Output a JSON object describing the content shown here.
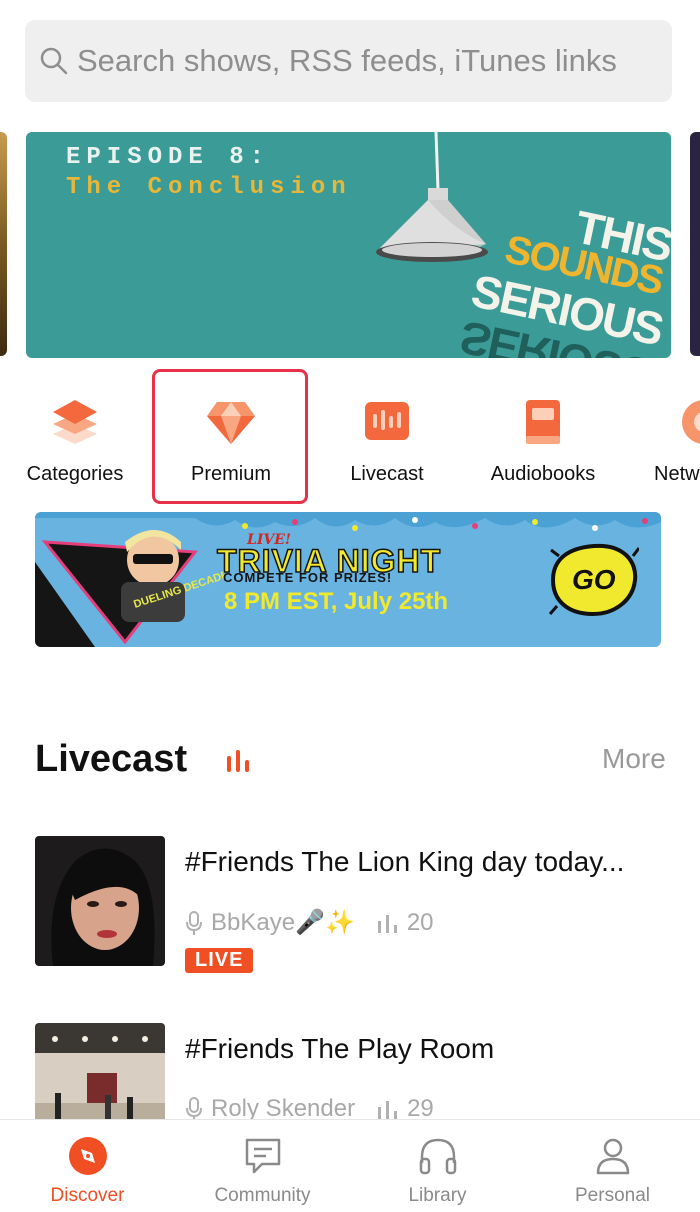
{
  "search": {
    "placeholder": "Search shows, RSS feeds, iTunes links"
  },
  "hero": {
    "line1": "EPISODE 8:",
    "line2": "The Conclusion",
    "brand_words": [
      "THIS",
      "SOUNDS",
      "SERIOUS"
    ]
  },
  "quick_menu": [
    {
      "label": "Categories",
      "icon": "layers-icon",
      "color": "#f4683e"
    },
    {
      "label": "Premium",
      "icon": "diamond-icon",
      "color": "#f7956a",
      "highlighted": true
    },
    {
      "label": "Livecast",
      "icon": "live-audio-icon",
      "color": "#f4683e"
    },
    {
      "label": "Audiobooks",
      "icon": "book-icon",
      "color": "#f4683e"
    },
    {
      "label": "Netw",
      "icon": "globe-icon",
      "color": "#f4683e"
    }
  ],
  "trivia_banner": {
    "live": "LIVE!",
    "title": "TRIVIA NIGHT",
    "subtitle": "COMPETE FOR PRIZES!",
    "date": "8 PM EST, July 25th",
    "cta": "GO",
    "host_logo_text": "DUELING DECADES"
  },
  "livecast": {
    "title": "Livecast",
    "more": "More",
    "items": [
      {
        "title": "#Friends The Lion King day today...",
        "host": "BbKaye🎤✨",
        "listeners": "20",
        "badge": "LIVE"
      },
      {
        "title": "#Friends The Play Room",
        "host": "Roly Skender",
        "listeners": "29"
      }
    ]
  },
  "tabs": [
    {
      "label": "Discover",
      "icon": "compass-icon",
      "active": true
    },
    {
      "label": "Community",
      "icon": "chat-icon",
      "active": false
    },
    {
      "label": "Library",
      "icon": "headphones-icon",
      "active": false
    },
    {
      "label": "Personal",
      "icon": "person-icon",
      "active": false
    }
  ],
  "colors": {
    "accent": "#f04e23",
    "highlight_box": "#e8304a",
    "hero_bg": "#3a9b97"
  }
}
